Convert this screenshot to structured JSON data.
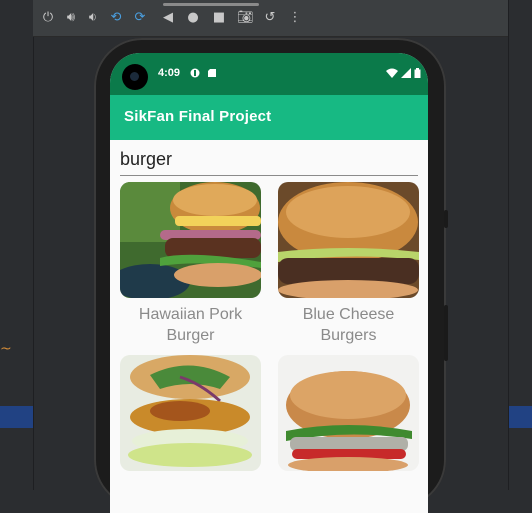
{
  "status": {
    "time": "4:09"
  },
  "app": {
    "title": "SikFan Final Project"
  },
  "search": {
    "value": "burger"
  },
  "recipes": [
    {
      "line1": "Hawaiian Pork",
      "line2": "Burger"
    },
    {
      "line1": "Blue Cheese",
      "line2": "Burgers"
    },
    {
      "line1": "",
      "line2": ""
    },
    {
      "line1": "",
      "line2": ""
    }
  ],
  "colors": {
    "status_bar": "#0b7a4a",
    "app_bar": "#17b983",
    "caption": "#8a8a8a"
  }
}
